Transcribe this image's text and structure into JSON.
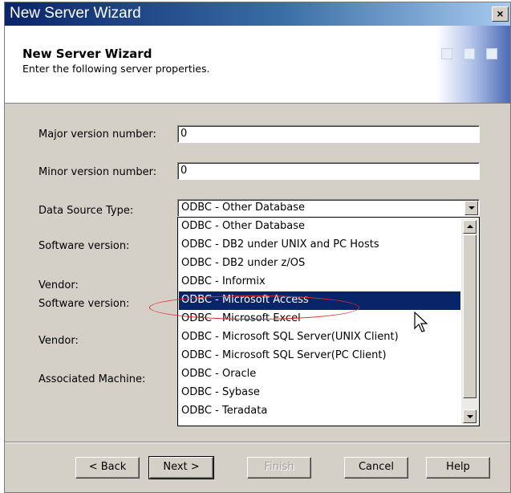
{
  "window": {
    "title": "New Server Wizard",
    "close_label": "×"
  },
  "header": {
    "title": "New Server Wizard",
    "subtitle": "Enter the following server properties."
  },
  "form": {
    "major_label": "Major version number:",
    "major_value": "0",
    "minor_label": "Minor version number:",
    "minor_value": "0",
    "datasource_label": "Data Source Type:",
    "datasource_value": "ODBC - Other Database",
    "software_label_1": "Software version:",
    "vendor_label_1": "Vendor:",
    "software_label_2": "Software version:",
    "vendor_label_2": "Vendor:",
    "machine_label": "Associated Machine:"
  },
  "dropdown": {
    "selected_index": 4,
    "items": [
      "ODBC - Other Database",
      "ODBC - DB2 under UNIX and PC  Hosts",
      "ODBC - DB2 under z/OS",
      "ODBC - Informix",
      "ODBC - Microsoft Access",
      "ODBC - Microsoft Excel",
      "ODBC - Microsoft SQL Server(UNIX Client)",
      "ODBC - Microsoft SQL Server(PC Client)",
      "ODBC - Oracle",
      "ODBC - Sybase",
      "ODBC - Teradata"
    ]
  },
  "buttons": {
    "back": "< Back",
    "next": "Next >",
    "finish": "Finish",
    "cancel": "Cancel",
    "help": "Help"
  },
  "colors": {
    "titlebar": "#0a246a",
    "selection": "#0a246a",
    "annotation": "#e02a2a",
    "dialog_face": "#d4d0c8"
  },
  "icons": [
    "close-icon",
    "chevron-down-icon",
    "scroll-up-icon",
    "scroll-down-icon",
    "mouse-pointer-icon"
  ]
}
